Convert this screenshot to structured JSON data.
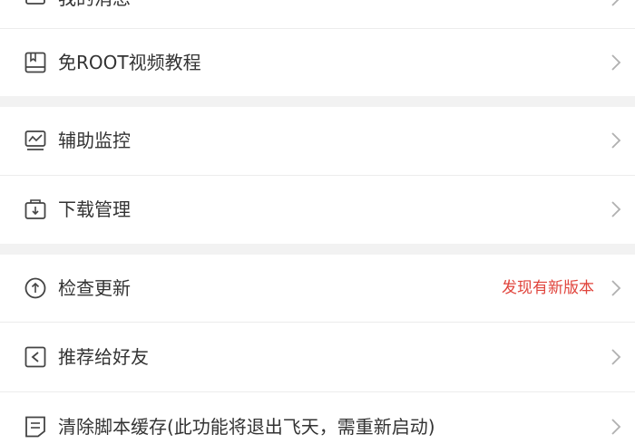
{
  "menu": {
    "section1": [
      {
        "label": "我的消息",
        "icon": "message-icon"
      },
      {
        "label": "免ROOT视频教程",
        "icon": "book-icon"
      }
    ],
    "section2": [
      {
        "label": "辅助监控",
        "icon": "monitor-chart-icon"
      },
      {
        "label": "下载管理",
        "icon": "download-box-icon"
      }
    ],
    "section3": [
      {
        "label": "检查更新",
        "icon": "upload-circle-icon",
        "extra": "发现有新版本"
      },
      {
        "label": "推荐给好友",
        "icon": "share-icon"
      },
      {
        "label": "清除脚本缓存(此功能将退出飞天，需重新启动)",
        "icon": "document-icon"
      }
    ]
  },
  "colors": {
    "accent_text": "#e0443c",
    "label_text": "#333333",
    "section_gap": "#f2f2f2"
  }
}
